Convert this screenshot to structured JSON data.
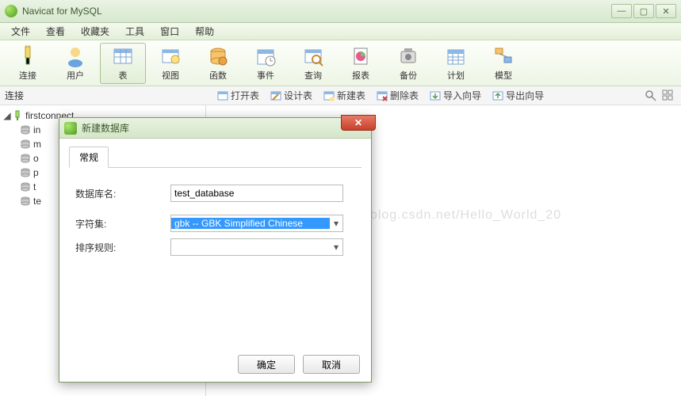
{
  "app": {
    "title": "Navicat for MySQL"
  },
  "menubar": {
    "file": "文件",
    "view": "查看",
    "favorites": "收藏夹",
    "tools": "工具",
    "window": "窗口",
    "help": "帮助"
  },
  "toolbar": {
    "connection": "连接",
    "user": "用户",
    "table": "表",
    "view": "视图",
    "function": "函数",
    "event": "事件",
    "query": "查询",
    "report": "报表",
    "backup": "备份",
    "schedule": "计划",
    "model": "模型"
  },
  "subbar": {
    "left_label": "连接",
    "open_table": "打开表",
    "design_table": "设计表",
    "new_table": "新建表",
    "delete_table": "删除表",
    "import_wizard": "导入向导",
    "export_wizard": "导出向导"
  },
  "sidebar": {
    "root": "firstconnect",
    "items": [
      {
        "label": "in"
      },
      {
        "label": "m"
      },
      {
        "label": "o"
      },
      {
        "label": "p"
      },
      {
        "label": "t"
      },
      {
        "label": "te"
      }
    ]
  },
  "watermark": "https://blog.csdn.net/Hello_World_20",
  "dialog": {
    "title": "新建数据库",
    "tab_general": "常规",
    "fields": {
      "db_name_label": "数据库名:",
      "db_name_value": "test_database",
      "charset_label": "字符集:",
      "charset_value": "gbk -- GBK Simplified Chinese",
      "collation_label": "排序规则:",
      "collation_value": ""
    },
    "buttons": {
      "ok": "确定",
      "cancel": "取消"
    }
  }
}
